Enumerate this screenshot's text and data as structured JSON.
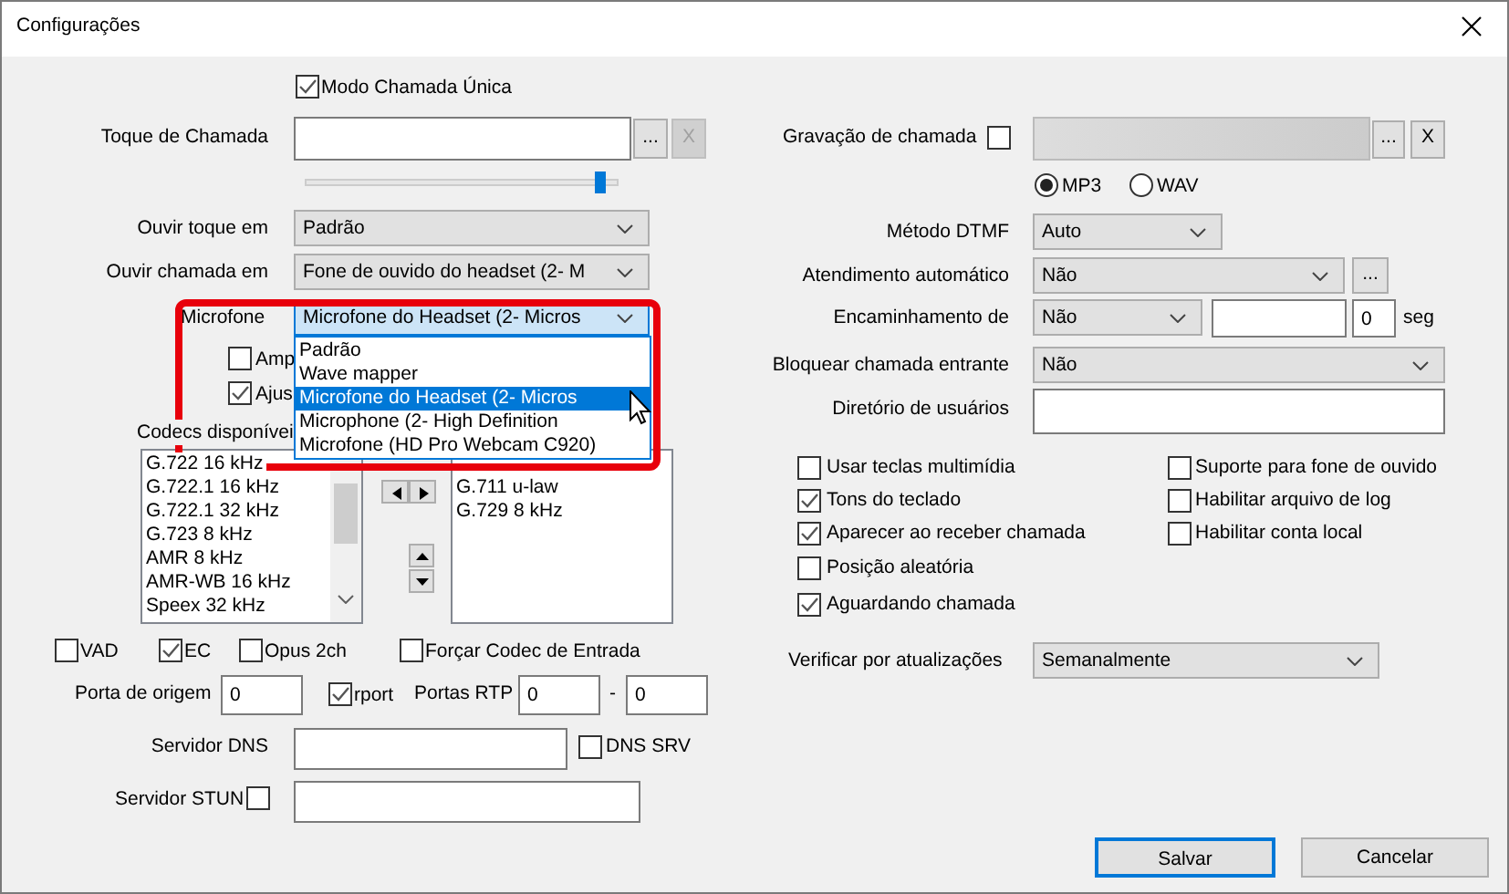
{
  "window": {
    "title": "Configurações"
  },
  "single_call_mode": {
    "label": "Modo Chamada Única",
    "checked": true
  },
  "ringtone": {
    "label": "Toque de Chamada",
    "browse": "...",
    "clear": "X",
    "clear_disabled": true,
    "volume": {
      "level": 0.97
    }
  },
  "ring_output": {
    "label": "Ouvir toque em",
    "value": "Padrão"
  },
  "call_output": {
    "label": "Ouvir chamada em",
    "value": "Fone de ouvido do headset (2- M"
  },
  "microphone": {
    "label": "Microfone",
    "value": "Microfone do Headset (2- Micros",
    "expanded": true,
    "options": [
      {
        "label": "Padrão",
        "selected": false
      },
      {
        "label": "Wave mapper",
        "selected": false
      },
      {
        "label": "Microfone do Headset (2- Micros",
        "selected": true
      },
      {
        "label": "Microphone (2- High Definition",
        "selected": false
      },
      {
        "label": "Microfone (HD Pro Webcam C920)",
        "selected": false
      }
    ]
  },
  "amplify": {
    "label": "Amp",
    "checked": false
  },
  "adjust": {
    "label": "Ajus",
    "checked": true
  },
  "codecs": {
    "label": "Codecs disponívei",
    "available": [
      "G.722 16 kHz",
      "G.722.1 16 kHz",
      "G.722.1 32 kHz",
      "G.723 8 kHz",
      "AMR 8 kHz",
      "AMR-WB 16 kHz",
      "Speex 32 kHz"
    ],
    "enabled": [
      "G.711 u-law",
      "G.729 8 kHz"
    ]
  },
  "audio_options": [
    {
      "label": "VAD",
      "checked": false
    },
    {
      "label": "EC",
      "checked": true
    },
    {
      "label": "Opus 2ch",
      "checked": false
    },
    {
      "label": "Forçar Codec de Entrada",
      "checked": false
    }
  ],
  "source_port": {
    "label": "Porta de origem",
    "value": "0"
  },
  "rport": {
    "label": "rport",
    "checked": true
  },
  "rtp_ports": {
    "label": "Portas RTP",
    "from": "0",
    "separator": "-",
    "to": "0"
  },
  "dns_server": {
    "label": "Servidor DNS",
    "srv": {
      "label": "DNS SRV",
      "checked": false
    }
  },
  "stun_server": {
    "label": "Servidor STUN",
    "checked": false
  },
  "call_recording": {
    "label": "Gravação de chamada",
    "checked": false,
    "browse": "...",
    "clear": "X",
    "formats": [
      {
        "label": "MP3",
        "selected": true
      },
      {
        "label": "WAV",
        "selected": false
      }
    ]
  },
  "dtmf_method": {
    "label": "Método DTMF",
    "value": "Auto"
  },
  "auto_answer": {
    "label": "Atendimento automático",
    "value": "Não",
    "more": "..."
  },
  "forwarding": {
    "label": "Encaminhamento de",
    "value": "Não",
    "delay": "0",
    "unit": "seg"
  },
  "block_incoming": {
    "label": "Bloquear chamada entrante",
    "value": "Não"
  },
  "user_directory": {
    "label": "Diretório de usuários"
  },
  "options_left": [
    {
      "label": "Usar teclas multimídia",
      "checked": false
    },
    {
      "label": "Tons do teclado",
      "checked": true
    },
    {
      "label": "Aparecer ao receber chamada",
      "checked": true
    },
    {
      "label": "Posição aleatória",
      "checked": false
    },
    {
      "label": "Aguardando chamada",
      "checked": true
    }
  ],
  "options_right": [
    {
      "label": "Suporte para fone de ouvido",
      "checked": false
    },
    {
      "label": "Habilitar arquivo de log",
      "checked": false
    },
    {
      "label": "Habilitar conta local",
      "checked": false
    }
  ],
  "update_check": {
    "label": "Verificar por atualizações",
    "value": "Semanalmente"
  },
  "buttons": [
    {
      "label": "Salvar",
      "default": true
    },
    {
      "label": "Cancelar",
      "default": false
    }
  ]
}
